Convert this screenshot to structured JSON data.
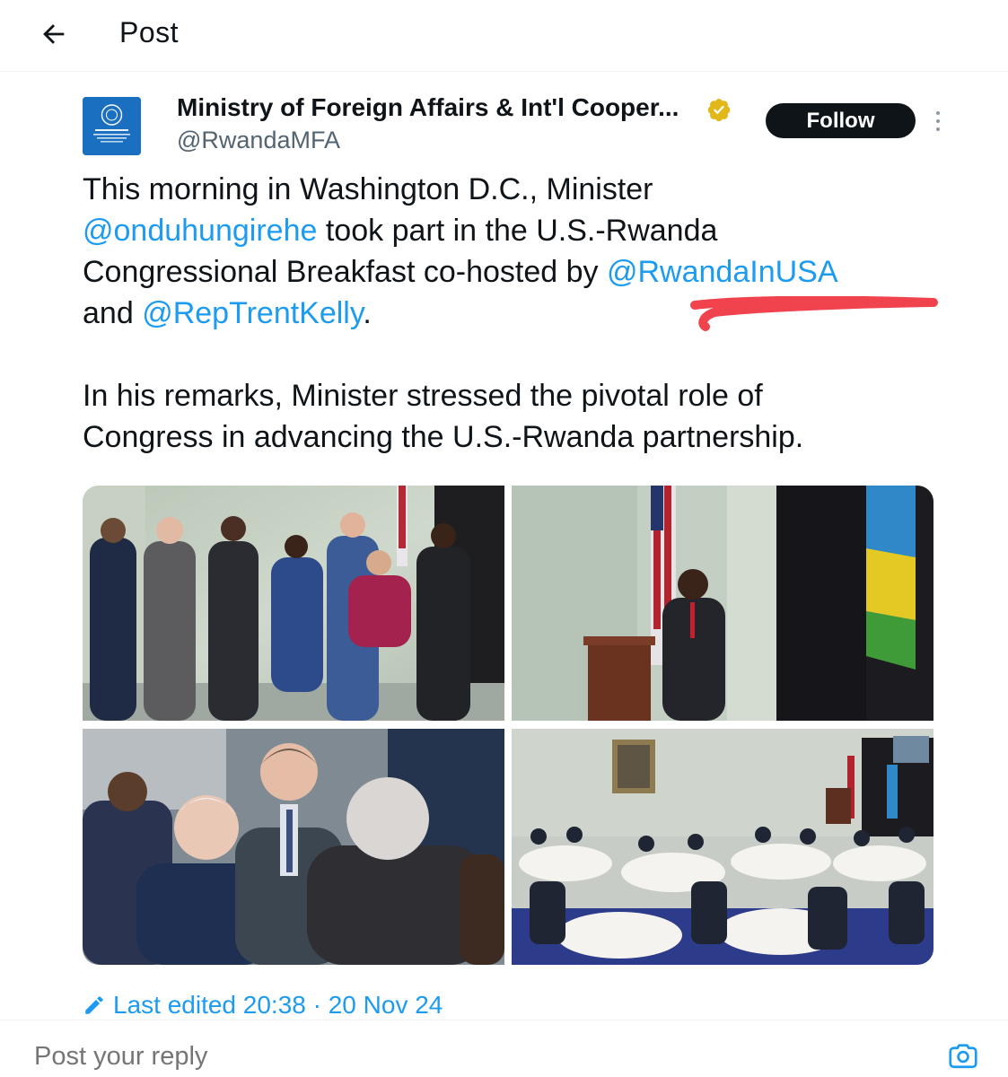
{
  "header": {
    "title": "Post",
    "back_icon": "arrow-left-icon"
  },
  "author": {
    "name": "Ministry of Foreign Affairs & Int'l Cooper...",
    "handle": "@RwandaMFA",
    "verified": true,
    "verified_color": "#e2b719",
    "avatar_text_lines": [
      "Republic of Rwanda",
      "Ministry of Foreign Affairs",
      "and International",
      "Cooperation"
    ]
  },
  "follow_button": "Follow",
  "tweet": {
    "line1": "This morning in Washington D.C., Minister",
    "mention1": "@onduhungirehe",
    "line2_rest": " took part in the U.S.-Rwanda",
    "line3_pre": "Congressional Breakfast co-hosted by ",
    "mention2": "@RwandaInUSA",
    "line4_pre": "and ",
    "mention3": "@RepTrentKelly",
    "line4_post": ".",
    "para2_line1": "In his remarks, Minister stressed the pivotal role of",
    "para2_line2": "Congress in advancing the U.S.-Rwanda partnership."
  },
  "photos": [
    {
      "name": "group-photo"
    },
    {
      "name": "podium-speech-photo"
    },
    {
      "name": "guests-conversation-photo"
    },
    {
      "name": "breakfast-hall-photo"
    }
  ],
  "meta": {
    "edited_label": "Last edited 20:38 · 20 Nov 24",
    "edit_icon": "pencil-icon"
  },
  "reply": {
    "placeholder": "Post your reply",
    "camera_icon": "camera-icon"
  },
  "colors": {
    "link": "#1d9bf0",
    "text": "#0f1419",
    "muted": "#536471",
    "highlight_mark": "#f0434d"
  }
}
